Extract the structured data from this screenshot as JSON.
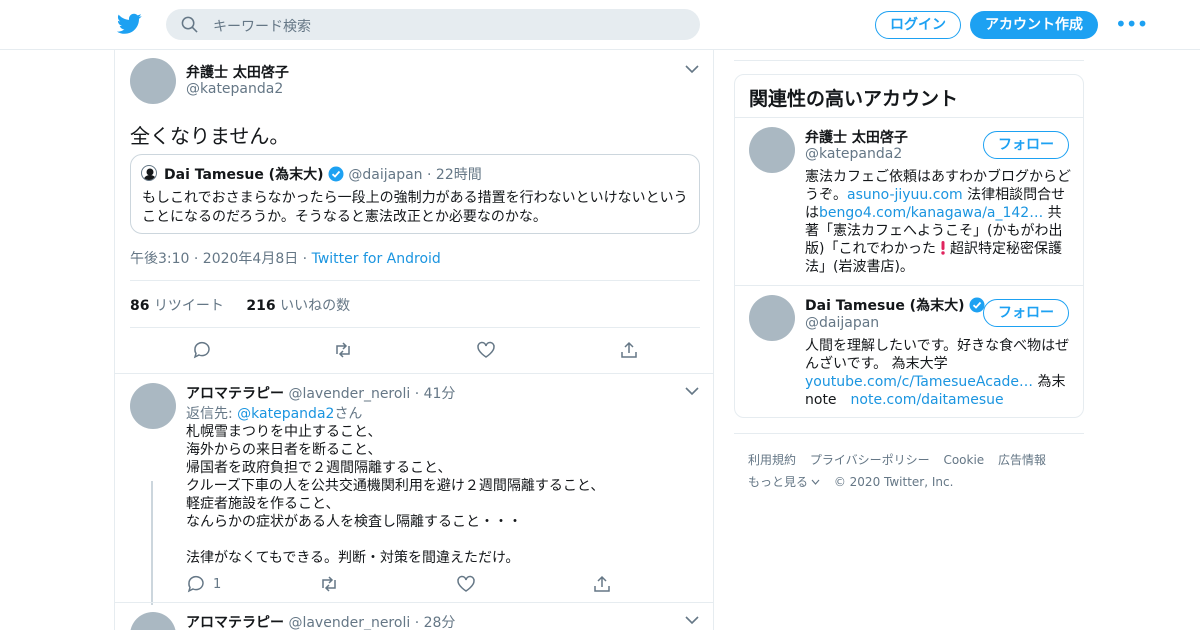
{
  "header": {
    "search_placeholder": "キーワード検索",
    "login_label": "ログイン",
    "signup_label": "アカウント作成",
    "more_label": "•••"
  },
  "tweet": {
    "name": "弁護士 太田啓子",
    "handle": "@katepanda2",
    "text": "全くなりません。",
    "quote": {
      "name": "Dai Tamesue (為末大)",
      "handle": "@daijapan",
      "separator": "·",
      "time": "22時間",
      "text": "もしこれでおさまらなかったら一段上の強制力がある措置を行わないといけないということになるのだろうか。そうなると憲法改正とか必要なのかな。"
    },
    "time": "午後3:10 · 2020年4月8日 · ",
    "source": "Twitter for Android",
    "retweets_count": "86",
    "retweets_label": "リツイート",
    "likes_count": "216",
    "likes_label": "いいねの数"
  },
  "replies": [
    {
      "name": "アロマテラピー",
      "handle": "@lavender_neroli",
      "separator": "·",
      "time": "41分",
      "reply_prefix": "返信先: ",
      "reply_to": "@katepanda2",
      "reply_suffix": "さん",
      "text": "札幌雪まつりを中止すること、\n海外からの来日者を断ること、\n帰国者を政府負担で２週間隔離すること、\nクルーズ下車の人を公共交通機関利用を避け２週間隔離すること、\n軽症者施設を作ること、\nなんらかの症状がある人を検査し隔離すること・・・\n\n法律がなくてもできる。判断・対策を間違えただけ。",
      "reply_count": "1"
    },
    {
      "name": "アロマテラピー",
      "handle": "@lavender_neroli",
      "separator": "·",
      "time": "28分"
    }
  ],
  "related": {
    "title": "関連性の高いアカウント",
    "follow_label": "フォロー",
    "accounts": [
      {
        "name": "弁護士 太田啓子",
        "handle": "@katepanda2",
        "bio_1": "憲法カフェご依頼はあすわかブログからどうぞ。",
        "link_1": "asuno-jiyuu.com",
        "bio_2": " 法律相談問合せは",
        "link_2": "bengo4.com/kanagawa/a_142…",
        "bio_3": " 共著「憲法カフェへようこそ」(かもがわ出版)「これでわかった",
        "bio_4": "超訳特定秘密保護法」(岩波書店)。"
      },
      {
        "name": "Dai Tamesue (為末大)",
        "handle": "@daijapan",
        "bio_1": "人間を理解したいです。好きな食べ物はぜんざいです。 為末大学　",
        "link_1": "youtube.com/c/TamesueAcade…",
        "bio_2": " 為末note　",
        "link_2": "note.com/daitamesue"
      }
    ]
  },
  "footer": {
    "links": [
      "利用規約",
      "プライバシーポリシー",
      "Cookie",
      "広告情報"
    ],
    "more_label": "もっと見る",
    "copyright": "© 2020 Twitter, Inc."
  },
  "colors": {
    "accent": "#1da1f2",
    "link": "#1b95e0",
    "muted": "#657786",
    "border": "#e6ecf0",
    "heart_icon": "#e0245e"
  }
}
